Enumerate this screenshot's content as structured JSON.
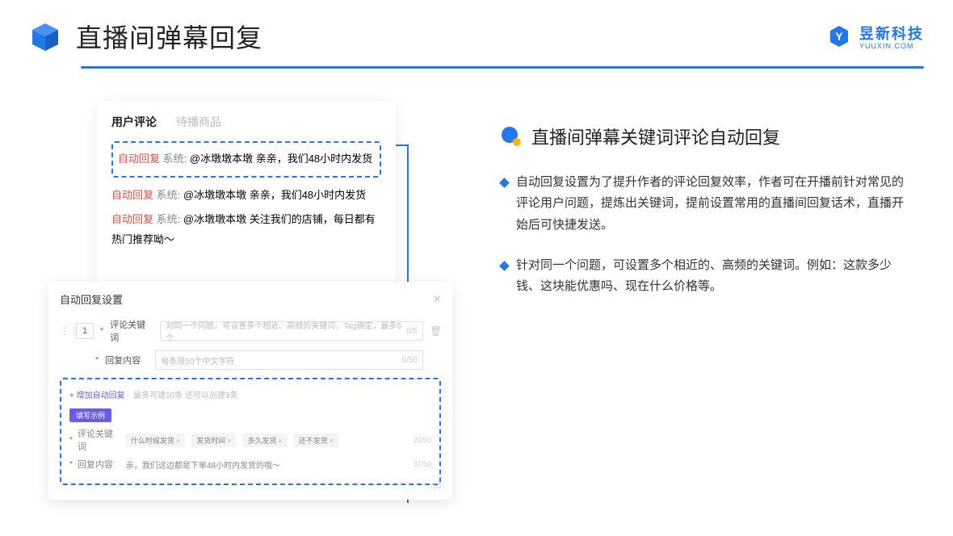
{
  "header": {
    "title": "直播间弹幕回复",
    "brand_name": "昱新科技",
    "brand_sub": "YUUXIN.COM"
  },
  "comments_card": {
    "tabs": {
      "active": "用户评论",
      "inactive": "待播商品"
    },
    "highlighted": {
      "tag": "自动回复",
      "system": "系统:",
      "text": "@冰墩墩本墩 亲亲，我们48小时内发货"
    },
    "list": [
      {
        "tag": "自动回复",
        "system": "系统:",
        "text": "@冰墩墩本墩 亲亲，我们48小时内发货"
      },
      {
        "tag": "自动回复",
        "system": "系统:",
        "text": "@冰墩墩本墩 关注我们的店铺，每日都有热门推荐呦～"
      }
    ]
  },
  "settings_card": {
    "title": "自动回复设置",
    "num": "1",
    "keyword_label": "评论关键词",
    "keyword_placeholder": "对同一个问题，可设置多个相近、高频的关键词，Tag确定，最多5个",
    "keyword_counter": "0/5",
    "content_label": "回复内容",
    "content_placeholder": "每条限50个中文字符",
    "content_counter": "0/50",
    "add_link": "+ 增加自动回复",
    "add_hint": "最多可建10条 还可以创建9条",
    "example_badge": "填写示例",
    "example_keyword_label": "评论关键词",
    "example_chips": [
      "什么时候发货",
      "发货时间",
      "多久发货",
      "还不发货"
    ],
    "example_keyword_counter": "20/50",
    "example_content_label": "回复内容",
    "example_content_text": "亲，我们这边都是下单48小时内发货的哦～",
    "example_content_counter": "37/50",
    "extra_counter": "/50"
  },
  "right": {
    "title": "直播间弹幕关键词评论自动回复",
    "bullets": [
      "自动回复设置为了提升作者的评论回复效率，作者可在开播前针对常见的评论用户问题，提炼出关键词，提前设置常用的直播间回复话术，直播开始后可快捷发送。",
      "针对同一个问题，可设置多个相近的、高频的关键词。例如：这款多少钱、这块能优惠吗、现在什么价格等。"
    ]
  }
}
